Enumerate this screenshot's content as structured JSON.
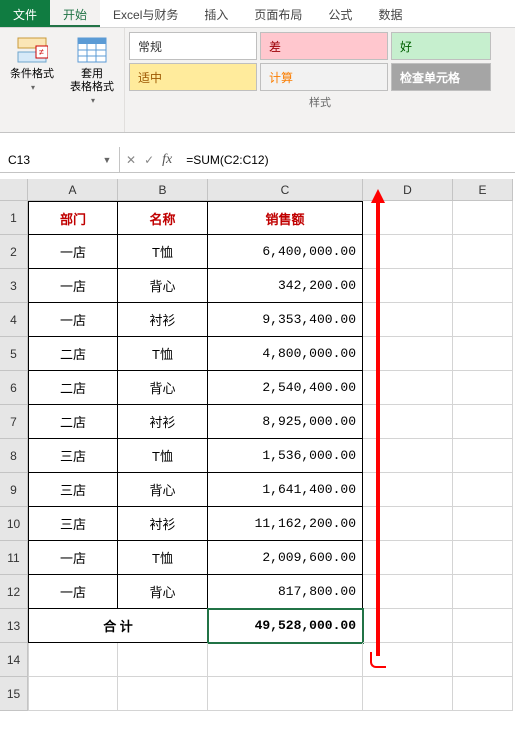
{
  "tabs": {
    "file": "文件",
    "home": "开始",
    "excel_finance": "Excel与财务",
    "insert": "插入",
    "page_layout": "页面布局",
    "formulas": "公式",
    "data": "数据"
  },
  "ribbon": {
    "cond_format": "条件格式",
    "table_format": "套用\n表格格式",
    "styles_label": "样式",
    "style_normal": "常规",
    "style_bad": "差",
    "style_good": "好",
    "style_neutral": "适中",
    "style_calc": "计算",
    "style_check": "检查单元格"
  },
  "namebox": "C13",
  "formula": "=SUM(C2:C12)",
  "columns": {
    "A": "A",
    "B": "B",
    "C": "C",
    "D": "D",
    "E": "E"
  },
  "headers": {
    "dept": "部门",
    "name": "名称",
    "sales": "销售额"
  },
  "rows": [
    {
      "n": "1"
    },
    {
      "n": "2",
      "dept": "一店",
      "name": "T恤",
      "sales": "6,400,000.00"
    },
    {
      "n": "3",
      "dept": "一店",
      "name": "背心",
      "sales": "342,200.00"
    },
    {
      "n": "4",
      "dept": "一店",
      "name": "衬衫",
      "sales": "9,353,400.00"
    },
    {
      "n": "5",
      "dept": "二店",
      "name": "T恤",
      "sales": "4,800,000.00"
    },
    {
      "n": "6",
      "dept": "二店",
      "name": "背心",
      "sales": "2,540,400.00"
    },
    {
      "n": "7",
      "dept": "二店",
      "name": "衬衫",
      "sales": "8,925,000.00"
    },
    {
      "n": "8",
      "dept": "三店",
      "name": "T恤",
      "sales": "1,536,000.00"
    },
    {
      "n": "9",
      "dept": "三店",
      "name": "背心",
      "sales": "1,641,400.00"
    },
    {
      "n": "10",
      "dept": "三店",
      "name": "衬衫",
      "sales": "11,162,200.00"
    },
    {
      "n": "11",
      "dept": "一店",
      "name": "T恤",
      "sales": "2,009,600.00"
    },
    {
      "n": "12",
      "dept": "一店",
      "name": "背心",
      "sales": "817,800.00"
    },
    {
      "n": "13"
    },
    {
      "n": "14"
    },
    {
      "n": "15"
    }
  ],
  "total": {
    "label": "合  计",
    "value": "49,528,000.00"
  },
  "chart_data": {
    "type": "table",
    "title": "销售额",
    "columns": [
      "部门",
      "名称",
      "销售额"
    ],
    "rows": [
      [
        "一店",
        "T恤",
        6400000.0
      ],
      [
        "一店",
        "背心",
        342200.0
      ],
      [
        "一店",
        "衬衫",
        9353400.0
      ],
      [
        "二店",
        "T恤",
        4800000.0
      ],
      [
        "二店",
        "背心",
        2540400.0
      ],
      [
        "二店",
        "衬衫",
        8925000.0
      ],
      [
        "三店",
        "T恤",
        1536000.0
      ],
      [
        "三店",
        "背心",
        1641400.0
      ],
      [
        "三店",
        "衬衫",
        11162200.0
      ],
      [
        "一店",
        "T恤",
        2009600.0
      ],
      [
        "一店",
        "背心",
        817800.0
      ]
    ],
    "total": 49528000.0
  }
}
